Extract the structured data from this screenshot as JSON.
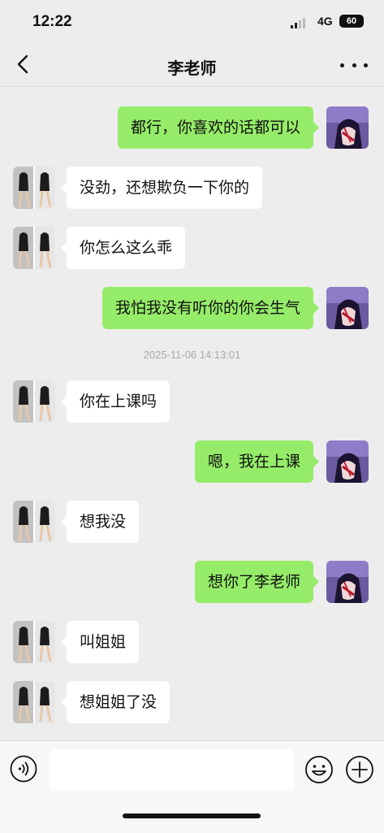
{
  "status_bar": {
    "time": "12:22",
    "network": "4G",
    "battery": "60"
  },
  "header": {
    "title": "李老师"
  },
  "colors": {
    "sent_bubble": "#95ec69",
    "received_bubble": "#ffffff",
    "background": "#ededed"
  },
  "messages": [
    {
      "side": "right",
      "text": "都行，你喜欢的话都可以"
    },
    {
      "side": "left",
      "text": "没劲，还想欺负一下你的"
    },
    {
      "side": "left",
      "text": "你怎么这么乖"
    },
    {
      "side": "right",
      "text": "我怕我没有听你的你会生气"
    },
    {
      "type": "timestamp",
      "text": "2025-11-06 14:13:01"
    },
    {
      "side": "left",
      "text": "你在上课吗"
    },
    {
      "side": "right",
      "text": "嗯，我在上课"
    },
    {
      "side": "left",
      "text": "想我没"
    },
    {
      "side": "right",
      "text": "想你了李老师"
    },
    {
      "side": "left",
      "text": "叫姐姐"
    },
    {
      "side": "left",
      "text": "想姐姐了没"
    }
  ],
  "input_bar": {
    "value": "",
    "placeholder": ""
  },
  "icons": [
    "back-icon",
    "more-icon",
    "voice-icon",
    "emoji-icon",
    "plus-icon"
  ]
}
